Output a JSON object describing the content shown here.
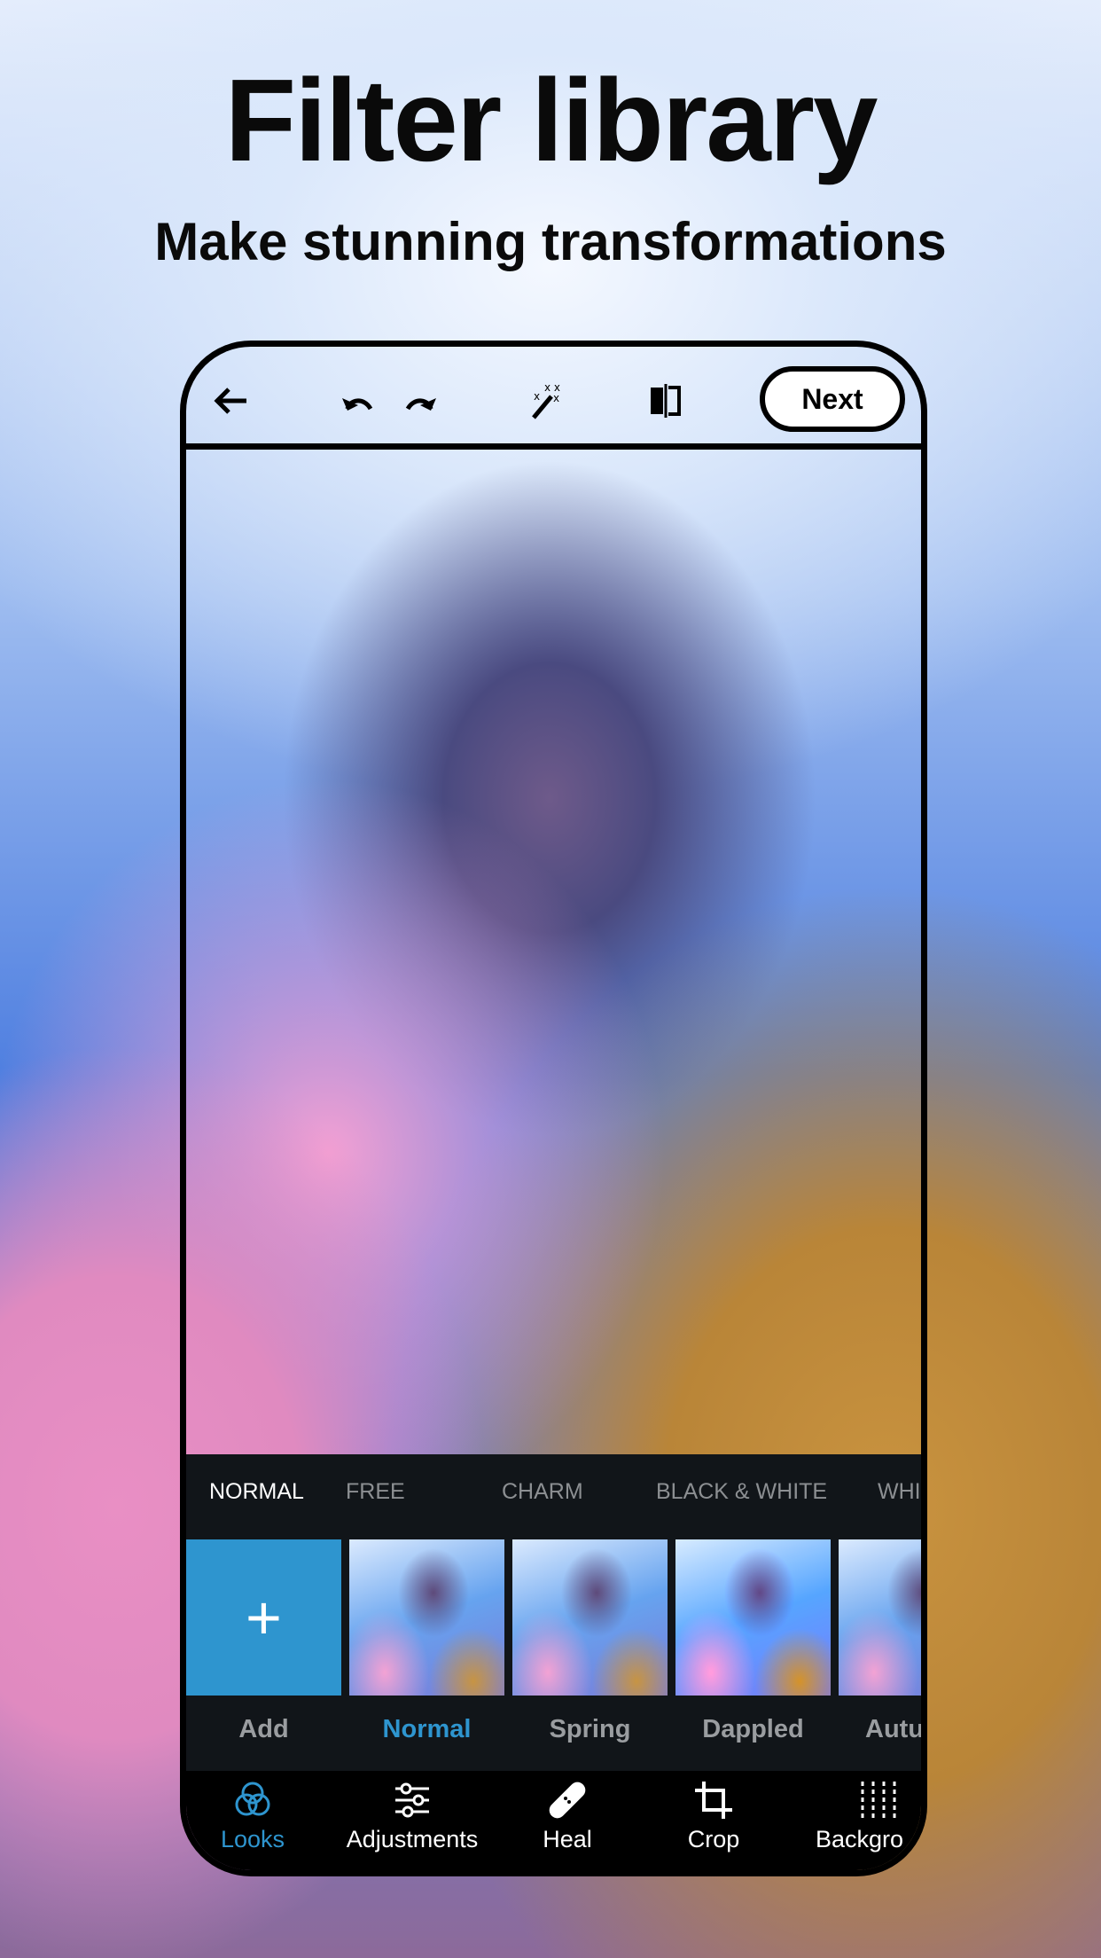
{
  "header": {
    "title": "Filter library",
    "subtitle": "Make stunning transformations"
  },
  "toolbar": {
    "back_icon": "arrow-left-icon",
    "undo_icon": "undo-icon",
    "redo_icon": "redo-icon",
    "auto_fix_icon": "magic-wand-icon",
    "compare_icon": "compare-icon",
    "next_label": "Next"
  },
  "categories": [
    "NORMAL",
    "FREE",
    "CHARM",
    "BLACK & WHITE",
    "WHI"
  ],
  "active_category": "NORMAL",
  "looks": [
    {
      "label": "Add"
    },
    {
      "label": "Normal"
    },
    {
      "label": "Spring"
    },
    {
      "label": "Dappled"
    },
    {
      "label": "Autu"
    }
  ],
  "add_symbol": "+",
  "selected_look": "Normal",
  "nav": [
    {
      "label": "Looks",
      "icon": "looks-icon"
    },
    {
      "label": "Adjustments",
      "icon": "sliders-icon"
    },
    {
      "label": "Heal",
      "icon": "bandage-icon"
    },
    {
      "label": "Crop",
      "icon": "crop-icon"
    },
    {
      "label": "Backgro",
      "icon": "background-icon"
    }
  ],
  "colors": {
    "accent": "#2e95cf",
    "panel": "#111519"
  }
}
